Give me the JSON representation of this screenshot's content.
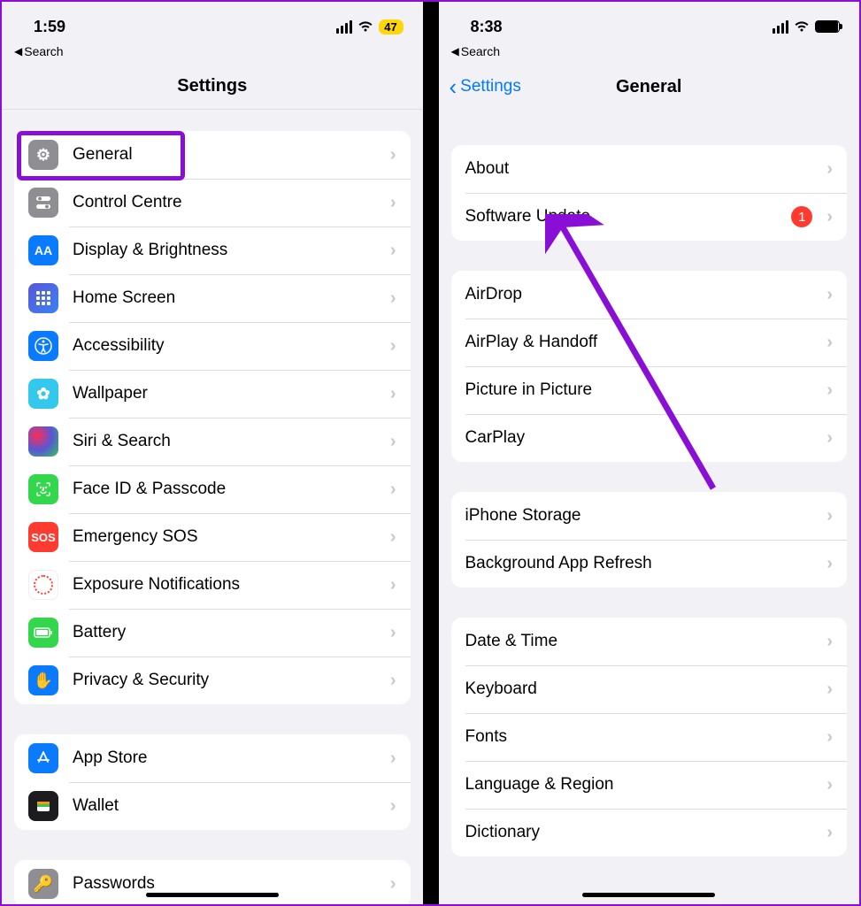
{
  "left": {
    "status": {
      "time": "1:59",
      "battery_text": "47"
    },
    "back_search": "Search",
    "title": "Settings",
    "groups": [
      {
        "rows": [
          {
            "icon": "gear-icon",
            "label": "General"
          },
          {
            "icon": "switches-icon",
            "label": "Control Centre"
          },
          {
            "icon": "display-icon",
            "label": "Display & Brightness"
          },
          {
            "icon": "grid-icon",
            "label": "Home Screen"
          },
          {
            "icon": "accessibility-icon",
            "label": "Accessibility"
          },
          {
            "icon": "flower-icon",
            "label": "Wallpaper"
          },
          {
            "icon": "siri-icon",
            "label": "Siri & Search"
          },
          {
            "icon": "face-id-icon",
            "label": "Face ID & Passcode"
          },
          {
            "icon": "sos-icon",
            "label": "Emergency SOS"
          },
          {
            "icon": "exposure-icon",
            "label": "Exposure Notifications"
          },
          {
            "icon": "battery-icon",
            "label": "Battery"
          },
          {
            "icon": "hand-icon",
            "label": "Privacy & Security"
          }
        ]
      },
      {
        "rows": [
          {
            "icon": "appstore-icon",
            "label": "App Store"
          },
          {
            "icon": "wallet-icon",
            "label": "Wallet"
          }
        ]
      },
      {
        "rows": [
          {
            "icon": "key-icon",
            "label": "Passwords"
          }
        ]
      }
    ]
  },
  "right": {
    "status": {
      "time": "8:38"
    },
    "back_search": "Search",
    "nav_back": "Settings",
    "title": "General",
    "groups": [
      {
        "rows": [
          {
            "label": "About"
          },
          {
            "label": "Software Update",
            "badge": "1"
          }
        ]
      },
      {
        "rows": [
          {
            "label": "AirDrop"
          },
          {
            "label": "AirPlay & Handoff"
          },
          {
            "label": "Picture in Picture"
          },
          {
            "label": "CarPlay"
          }
        ]
      },
      {
        "rows": [
          {
            "label": "iPhone Storage"
          },
          {
            "label": "Background App Refresh"
          }
        ]
      },
      {
        "rows": [
          {
            "label": "Date & Time"
          },
          {
            "label": "Keyboard"
          },
          {
            "label": "Fonts"
          },
          {
            "label": "Language & Region"
          },
          {
            "label": "Dictionary"
          }
        ]
      }
    ]
  },
  "annotation": {
    "highlight_target": "General",
    "arrow_target": "Software Update",
    "accent_color": "#8a0fd6"
  }
}
